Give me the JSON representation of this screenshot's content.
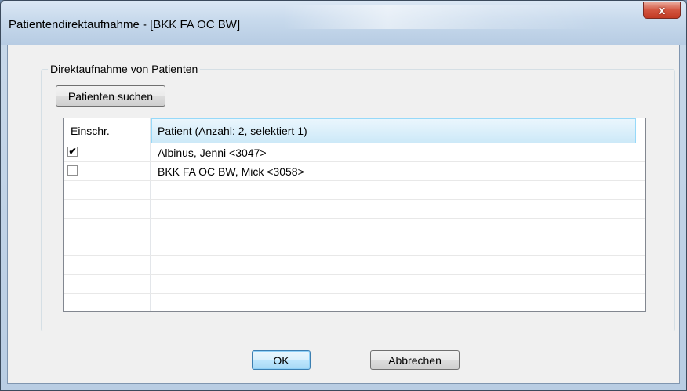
{
  "window": {
    "title": "Patientendirektaufnahme - [BKK FA OC BW]",
    "close_glyph": "x"
  },
  "group": {
    "label": "Direktaufnahme von Patienten",
    "search_button": "Patienten suchen"
  },
  "list": {
    "columns": [
      "Einschr.",
      "Patient (Anzahl: 2, selektiert 1)"
    ],
    "rows": [
      {
        "checked": true,
        "check_glyph": "✔",
        "patient": "Albinus, Jenni <3047>"
      },
      {
        "checked": false,
        "check_glyph": "",
        "patient": "BKK FA OC BW, Mick <3058>"
      }
    ]
  },
  "buttons": {
    "ok": "OK",
    "cancel": "Abbrechen"
  },
  "colors": {
    "accent": "#3c7fb1",
    "header_highlight": "#cde9f8",
    "close_red": "#c23a24"
  }
}
